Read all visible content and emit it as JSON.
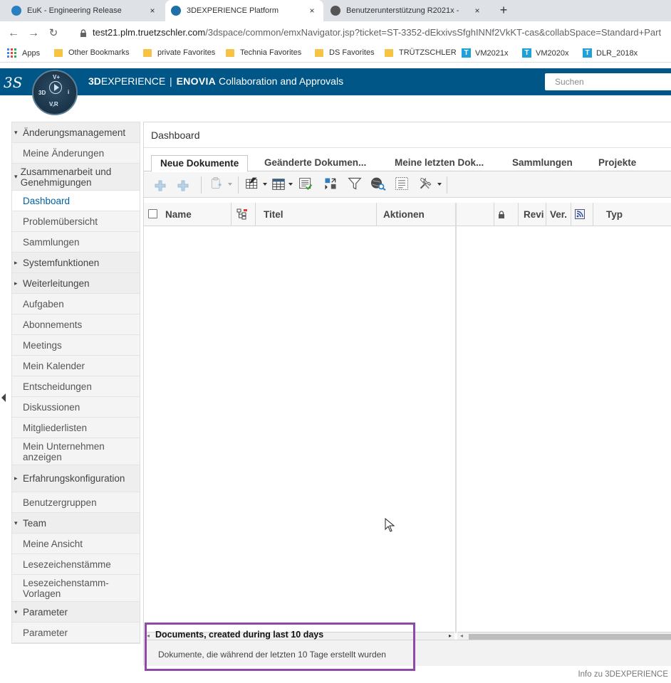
{
  "browser": {
    "tabs": [
      {
        "label": "EuK - Engineering Release",
        "active": false
      },
      {
        "label": "3DEXPERIENCE Platform",
        "active": true
      },
      {
        "label": "Benutzerunterstützung R2021x - ",
        "active": false
      }
    ],
    "close_glyph": "×",
    "new_tab_glyph": "+",
    "url_host": "test21.plm.truetzschler.com",
    "url_path": "/3dspace/common/emxNavigator.jsp?ticket=ST-3352-dEkxivsSfghINNf2VkKT-cas&collabSpace=Standard+Part",
    "bookmarks": [
      "Apps",
      "Other Bookmarks",
      "private Favorites",
      "Technia Favorites",
      "DS Favorites",
      "TRÜTZSCHLER",
      "VM2021x",
      "VM2020x",
      "DLR_2018x"
    ],
    "bookmark_t_glyph": "T"
  },
  "header": {
    "ds_logo": "3S",
    "compass_top": "V+",
    "compass_left": "3D",
    "compass_right": "i",
    "compass_bottom": "V,R",
    "brand_bold": "3D",
    "brand_rest": "EXPERIENCE",
    "separator": "|",
    "app_brand": "ENOVIA",
    "app_name": "Collaboration and Approvals",
    "search_placeholder": "Suchen",
    "colors": {
      "bar": "#005686",
      "accent": "#00629e",
      "highlight_box": "#8e4aa8"
    }
  },
  "menu": {
    "items": [
      {
        "label": "Änderungsmanagement",
        "type": "category"
      },
      {
        "label": "Meine Änderungen",
        "type": "item"
      },
      {
        "label": "Zusammenarbeit und Genehmigungen",
        "type": "category"
      },
      {
        "label": "Dashboard",
        "type": "selected"
      },
      {
        "label": "Problemübersicht",
        "type": "item"
      },
      {
        "label": "Sammlungen",
        "type": "item"
      },
      {
        "label": "Systemfunktionen",
        "type": "collapsed"
      },
      {
        "label": "Weiterleitungen",
        "type": "collapsed"
      },
      {
        "label": "Aufgaben",
        "type": "item"
      },
      {
        "label": "Abonnements",
        "type": "item"
      },
      {
        "label": "Meetings",
        "type": "item"
      },
      {
        "label": "Mein Kalender",
        "type": "item"
      },
      {
        "label": "Entscheidungen",
        "type": "item"
      },
      {
        "label": "Diskussionen",
        "type": "item"
      },
      {
        "label": "Mitgliederlisten",
        "type": "item"
      },
      {
        "label": "Mein Unternehmen anzeigen",
        "type": "item"
      },
      {
        "label": "Erfahrungskonfiguration",
        "type": "collapsed"
      },
      {
        "label": "Benutzergruppen",
        "type": "item"
      },
      {
        "label": "Team",
        "type": "category"
      },
      {
        "label": "Meine Ansicht",
        "type": "item"
      },
      {
        "label": "Lesezeichenstämme",
        "type": "item"
      },
      {
        "label": "Lesezeichenstamm-Vorlagen",
        "type": "item"
      },
      {
        "label": "Parameter",
        "type": "category"
      },
      {
        "label": "Parameter",
        "type": "item"
      }
    ],
    "expanded_caret": "▾",
    "collapsed_caret": "▸"
  },
  "main": {
    "title": "Dashboard",
    "tabs": [
      "Neue Dokumente",
      "Geänderte Dokumen...",
      "Meine letzten Dok...",
      "Sammlungen",
      "Projekte"
    ],
    "columns_left": [
      "Name",
      "Titel",
      "Aktionen"
    ],
    "columns_right": [
      "Revi",
      "Ver.",
      "Typ"
    ],
    "filter_title": "Documents, created during last 10 days",
    "filter_subtitle": "Dokumente, die während der letzten 10 Tage erstellt wurden"
  },
  "footer": {
    "about": "Info zu 3DEXPERIENCE"
  }
}
